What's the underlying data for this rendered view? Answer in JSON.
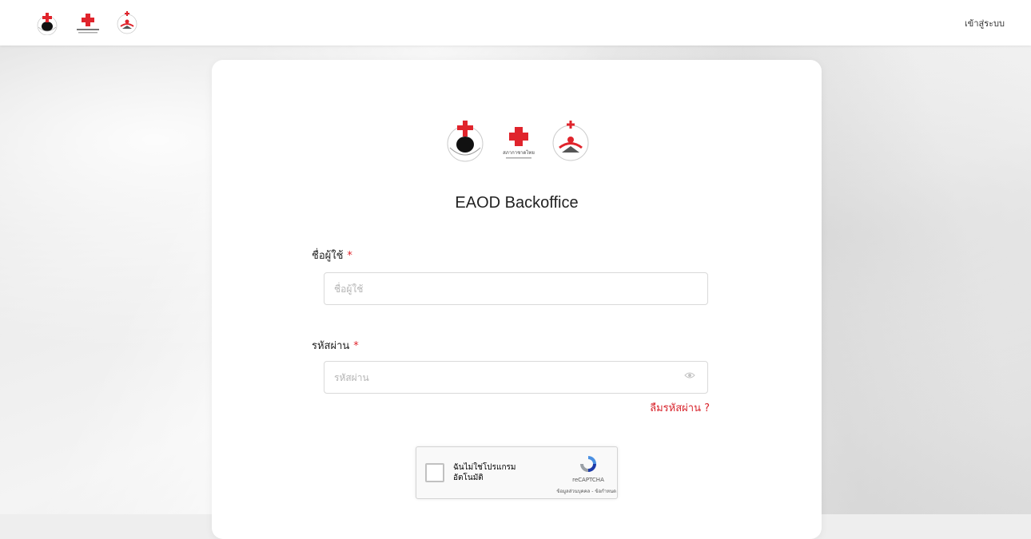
{
  "header": {
    "login_link": "เข้าสู่ระบบ"
  },
  "logos": [
    "eye-bank-logo",
    "thai-red-cross-logo",
    "organ-donation-center-logo"
  ],
  "logo_text": {
    "thai_red_cross": "สภากาชาดไทย"
  },
  "login_form": {
    "title": "EAOD Backoffice",
    "username_label": "ชื่อผู้ใช้",
    "username_placeholder": "ชื่อผู้ใช้",
    "username_value": "",
    "password_label": "รหัสผ่าน",
    "password_placeholder": "รหัสผ่าน",
    "password_value": "",
    "required_mark": "*",
    "forgot_password": "ลืมรหัสผ่าน ?"
  },
  "recaptcha": {
    "label": "ฉันไม่ใช่โปรแกรมอัตโนมัติ",
    "brand": "reCAPTCHA",
    "terms": "ข้อมูลส่วนบุคคล - ข้อกำหนด"
  },
  "colors": {
    "accent_red": "#e0242c",
    "link_red": "#d8242c"
  }
}
